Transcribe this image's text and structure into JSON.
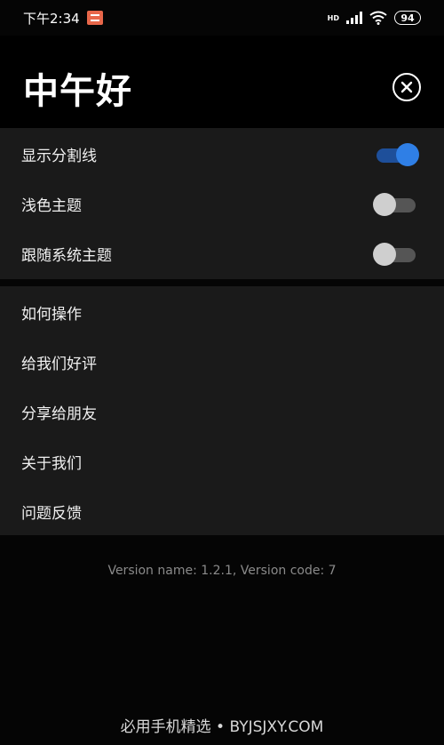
{
  "status_bar": {
    "time": "下午2:34",
    "network_label": "HD",
    "battery": "94"
  },
  "header": {
    "greeting": "中午好"
  },
  "settings": {
    "toggles": [
      {
        "label": "显示分割线",
        "on": true
      },
      {
        "label": "浅色主题",
        "on": false
      },
      {
        "label": "跟随系统主题",
        "on": false
      }
    ]
  },
  "menu": {
    "items": [
      {
        "label": "如何操作"
      },
      {
        "label": "给我们好评"
      },
      {
        "label": "分享给朋友"
      },
      {
        "label": "关于我们"
      },
      {
        "label": "问题反馈"
      }
    ]
  },
  "footer": {
    "version": "Version name: 1.2.1, Version code: 7",
    "watermark": "必用手机精选 • BYJSJXY.COM"
  },
  "colors": {
    "accent": "#2f7fe6",
    "background": "#050505",
    "panel": "#1a1a1a"
  }
}
